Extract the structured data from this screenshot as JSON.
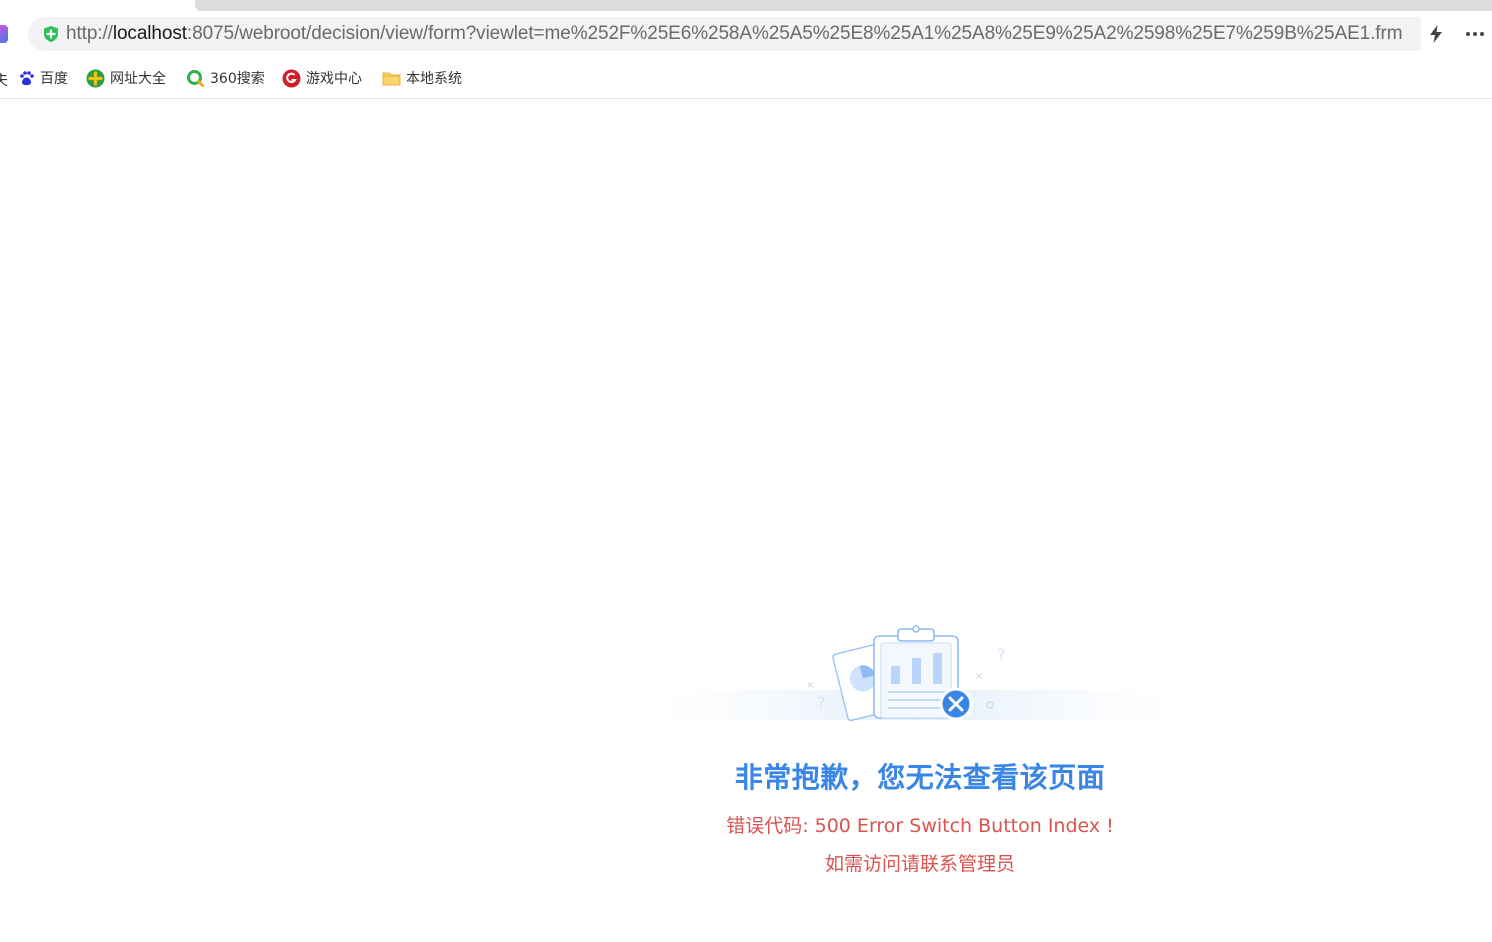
{
  "browser": {
    "url_prefix": "http://",
    "url_host": "localhost",
    "url_rest": ":8075/webroot/decision/view/form?viewlet=me%252F%25E6%258A%25A5%25E8%25A1%25A8%25E9%25A2%2598%25E7%259B%25AE1.frm",
    "bookmarks_cut_label": "夫",
    "bookmarks": [
      {
        "label": "百度",
        "icon": "baidu-paw-icon",
        "color": "#2932e1"
      },
      {
        "label": "网址大全",
        "icon": "navigation-plus-icon",
        "color": "#f0c419"
      },
      {
        "label": "360搜索",
        "icon": "360-search-icon",
        "color": "#2bb24c"
      },
      {
        "label": "游戏中心",
        "icon": "game-center-icon",
        "color": "#d0202a"
      },
      {
        "label": "本地系统",
        "icon": "folder-icon",
        "color": "#f4c542"
      }
    ]
  },
  "error": {
    "title": "非常抱歉，您无法查看该页面",
    "code": "错误代码: 500 Error Switch Button Index !",
    "contact": "如需访问请联系管理员",
    "title_color": "#3a86e8",
    "text_color": "#d9534f"
  }
}
